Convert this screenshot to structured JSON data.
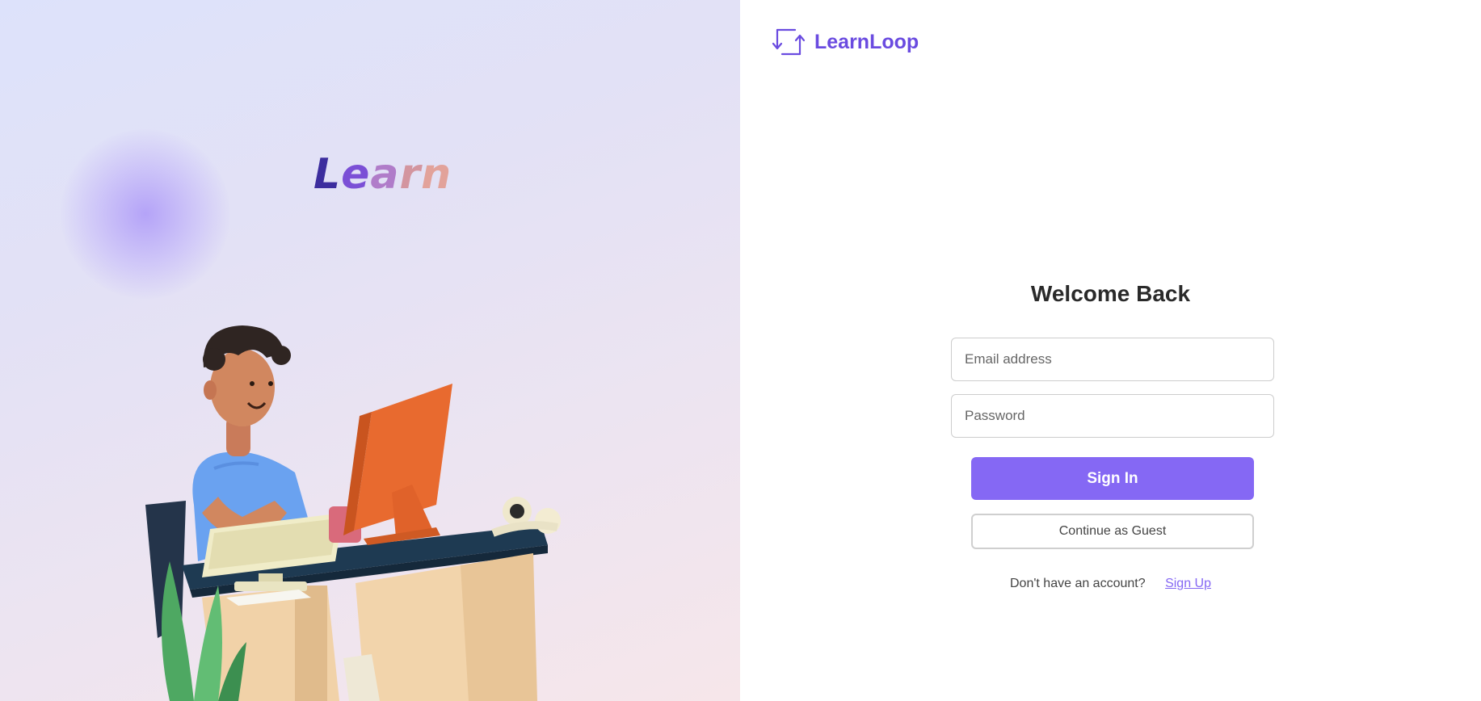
{
  "hero": {
    "word": [
      "L",
      "e",
      "a",
      "r",
      "n"
    ]
  },
  "brand": {
    "name": "LearnLoop",
    "icon": "loop-arrows-icon",
    "color": "#6a4be0"
  },
  "form": {
    "title": "Welcome Back",
    "email_placeholder": "Email address",
    "password_placeholder": "Password",
    "sign_in_label": "Sign In",
    "guest_label": "Continue as Guest",
    "signup_prompt": "Don't have an account?",
    "signup_link": "Sign Up"
  },
  "colors": {
    "accent": "#8568f4",
    "title": "#2a2a2a"
  }
}
